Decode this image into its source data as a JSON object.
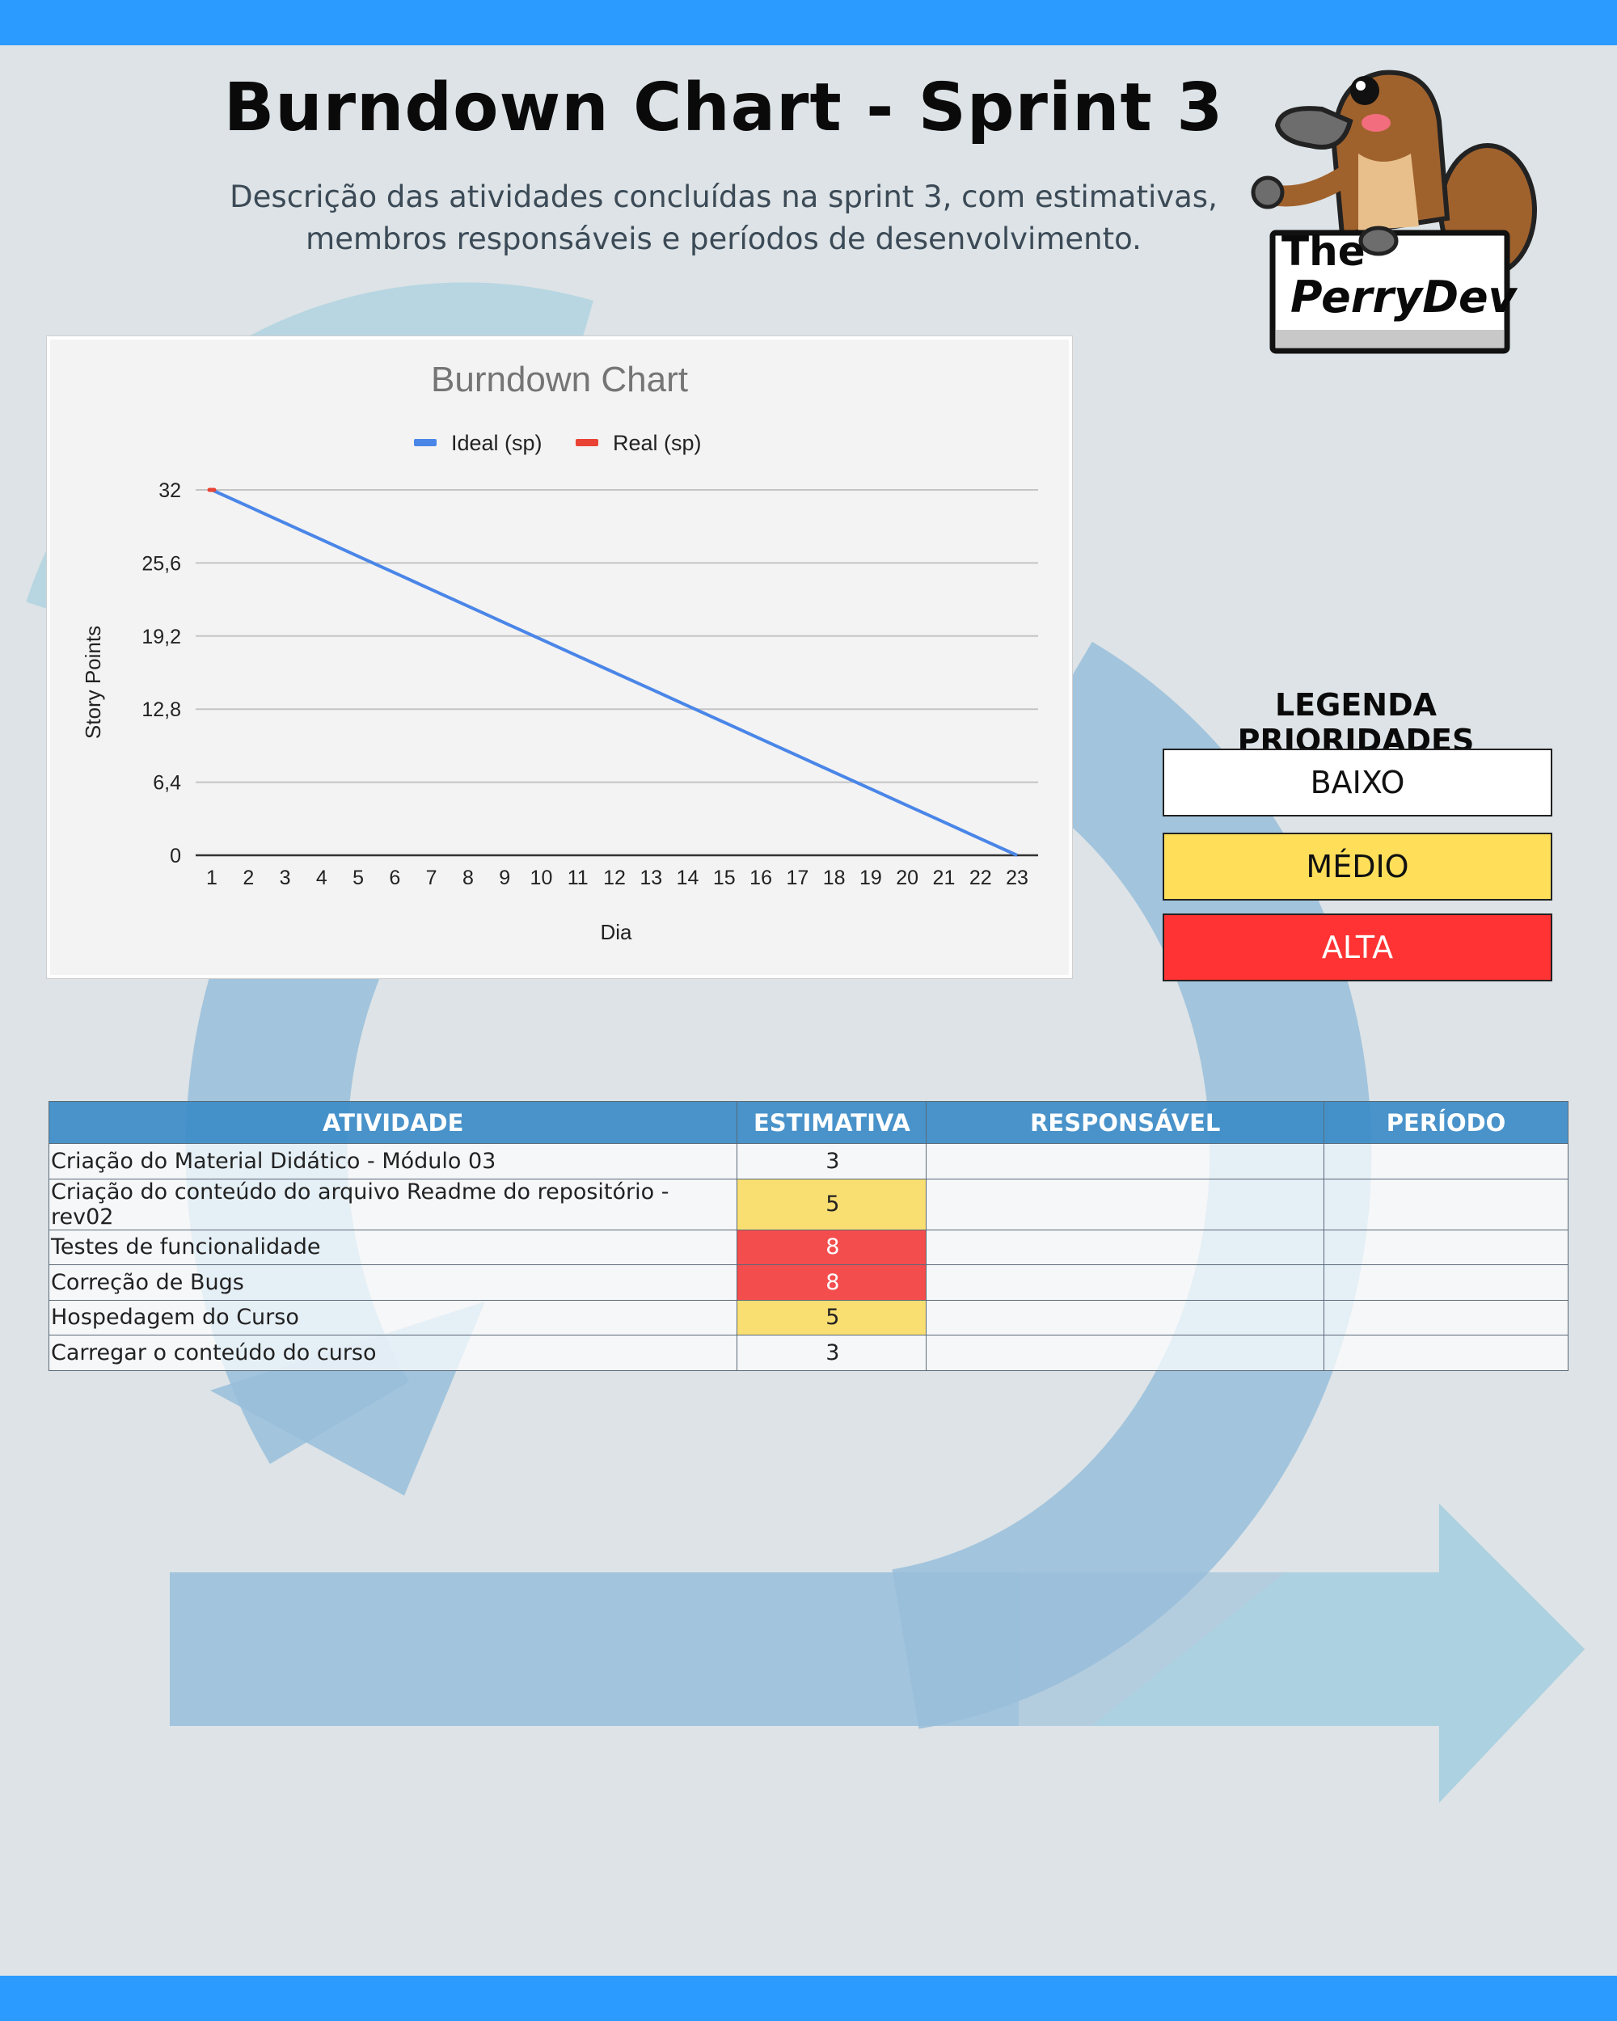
{
  "header": {
    "title": "Burndown Chart - Sprint 3",
    "subtitle_line1": "Descrição das atividades concluídas na sprint 3, com estimativas,",
    "subtitle_line2": "membros responsáveis e períodos de desenvolvimento."
  },
  "logo": {
    "line1": "The",
    "line2": "PerryDev"
  },
  "colors": {
    "top_bar": "#2b9bff",
    "ideal_series": "#4a86e8",
    "real_series": "#ea4335",
    "priority_low": "#ffffff",
    "priority_medium": "#ffdf5a",
    "priority_high": "#ff3333"
  },
  "chart_data": {
    "type": "line",
    "title": "Burndown Chart",
    "xlabel": "Dia",
    "ylabel": "Story Points",
    "x": [
      1,
      2,
      3,
      4,
      5,
      6,
      7,
      8,
      9,
      10,
      11,
      12,
      13,
      14,
      15,
      16,
      17,
      18,
      19,
      20,
      21,
      22,
      23
    ],
    "ylim": [
      0,
      32
    ],
    "yticks": [
      "0",
      "6,4",
      "12,8",
      "19,2",
      "25,6",
      "32"
    ],
    "ytick_values": [
      0,
      6.4,
      12.8,
      19.2,
      25.6,
      32
    ],
    "grid": true,
    "legend_position": "top",
    "series": [
      {
        "name": "Ideal (sp)",
        "color": "#4a86e8",
        "values": [
          32,
          30.55,
          29.09,
          27.64,
          26.18,
          24.73,
          23.27,
          21.82,
          20.36,
          18.91,
          17.45,
          16,
          14.55,
          13.09,
          11.64,
          10.18,
          8.73,
          7.27,
          5.82,
          4.36,
          2.91,
          1.45,
          0
        ]
      },
      {
        "name": "Real (sp)",
        "color": "#ea4335",
        "values": [
          32
        ]
      }
    ]
  },
  "legend_priorities": {
    "title": "LEGENDA PRIORIDADES",
    "low": "BAIXO",
    "medium": "MÉDIO",
    "high": "ALTA"
  },
  "table": {
    "headers": [
      "ATIVIDADE",
      "ESTIMATIVA",
      "RESPONSÁVEL",
      "PERÍODO"
    ],
    "rows": [
      {
        "activity": "Criação do Material Didático - Módulo 03",
        "estimate": "3",
        "priority": "low",
        "responsible": "",
        "period": ""
      },
      {
        "activity": "Criação do conteúdo do arquivo Readme do repositório - rev02",
        "estimate": "5",
        "priority": "medium",
        "responsible": "",
        "period": ""
      },
      {
        "activity": "Testes de funcionalidade",
        "estimate": "8",
        "priority": "high",
        "responsible": "",
        "period": ""
      },
      {
        "activity": "Correção de Bugs",
        "estimate": "8",
        "priority": "high",
        "responsible": "",
        "period": ""
      },
      {
        "activity": "Hospedagem do Curso",
        "estimate": "5",
        "priority": "medium",
        "responsible": "",
        "period": ""
      },
      {
        "activity": "Carregar o conteúdo do curso",
        "estimate": "3",
        "priority": "low",
        "responsible": "",
        "period": ""
      }
    ]
  }
}
